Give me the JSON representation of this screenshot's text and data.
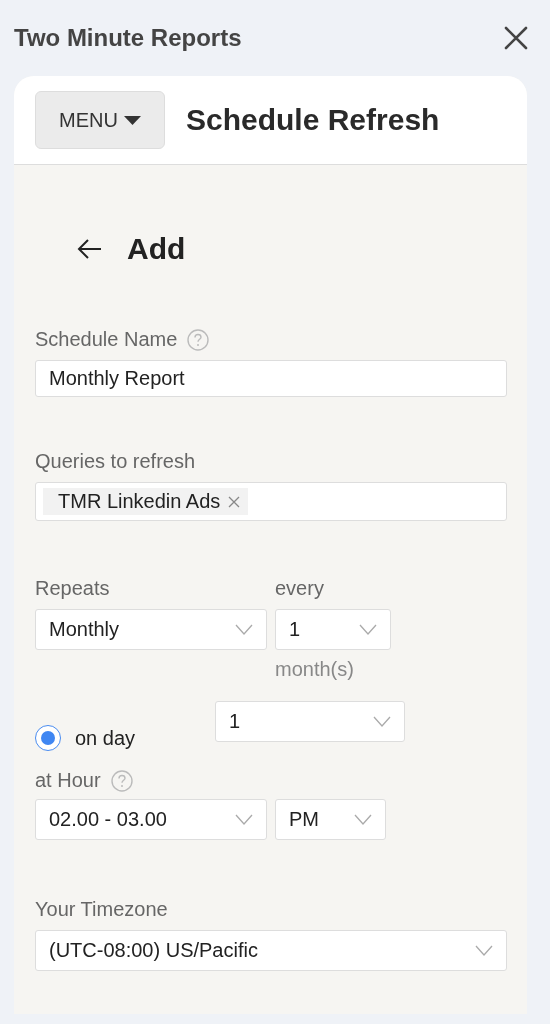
{
  "panel": {
    "title": "Two Minute Reports"
  },
  "header": {
    "menu_button": "MENU",
    "title": "Schedule Refresh"
  },
  "page": {
    "title": "Add"
  },
  "schedule_name": {
    "label": "Schedule Name",
    "value": "Monthly Report"
  },
  "queries": {
    "label": "Queries to refresh",
    "tags": [
      "TMR Linkedin Ads"
    ]
  },
  "repeats": {
    "label": "Repeats",
    "value": "Monthly"
  },
  "every": {
    "label": "every",
    "value": "1",
    "unit": "month(s)"
  },
  "on_day": {
    "label": "on day",
    "selected": true,
    "value": "1"
  },
  "hour": {
    "label": "at Hour",
    "value": "02.00 - 03.00",
    "period": "PM"
  },
  "timezone": {
    "label": "Your Timezone",
    "value": "(UTC-08:00) US/Pacific"
  }
}
